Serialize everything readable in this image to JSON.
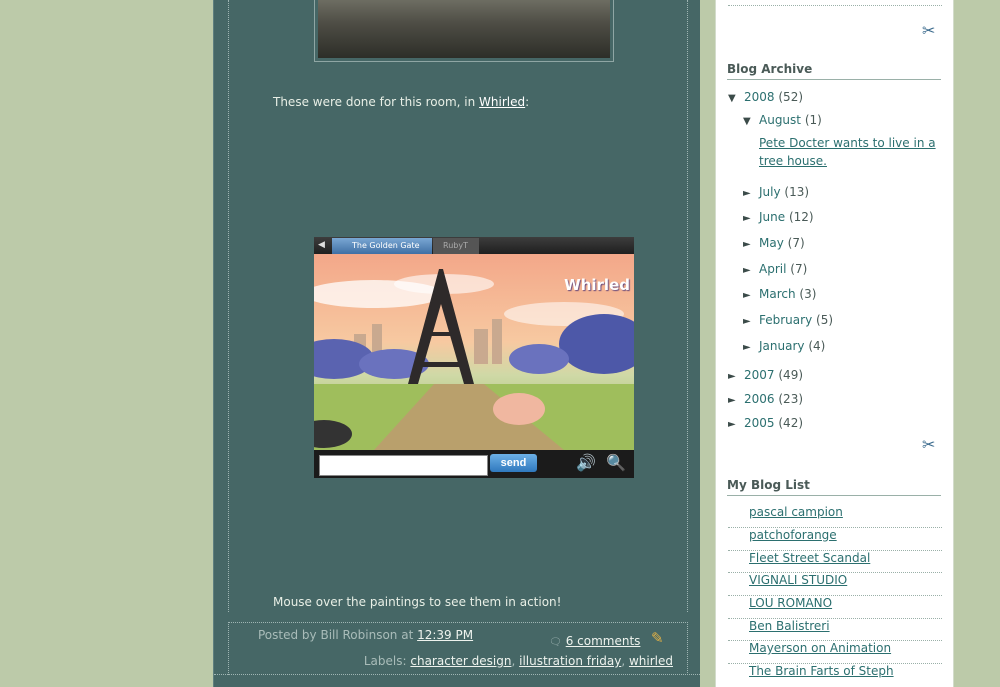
{
  "post": {
    "intro_text": "These were done for this room, in ",
    "intro_link": "Whirled",
    "intro_suffix": ":",
    "game_tab_active": "The Golden Gate",
    "game_tab_other": "RubyT",
    "game_logo": "Whirled",
    "send_label": "send",
    "mouseover_text": "Mouse over the paintings to see them in action!",
    "posted_by": "Posted by Bill Robinson at",
    "time": "12:39 PM",
    "comments": "6 comments",
    "labels_prefix": "Labels:",
    "labels": [
      "character design",
      "illustration friday",
      "whirled"
    ]
  },
  "sidebar": {
    "archive_title": "Blog Archive",
    "archive": [
      {
        "tri": "▼",
        "label": "2008",
        "count": "(52)"
      },
      {
        "tri": "▼",
        "label": "August",
        "count": "(1)"
      },
      {
        "tri": "►",
        "label": "July",
        "count": "(13)"
      },
      {
        "tri": "►",
        "label": "June",
        "count": "(12)"
      },
      {
        "tri": "►",
        "label": "May",
        "count": "(7)"
      },
      {
        "tri": "►",
        "label": "April",
        "count": "(7)"
      },
      {
        "tri": "►",
        "label": "March",
        "count": "(3)"
      },
      {
        "tri": "►",
        "label": "February",
        "count": "(5)"
      },
      {
        "tri": "►",
        "label": "January",
        "count": "(4)"
      },
      {
        "tri": "►",
        "label": "2007",
        "count": "(49)"
      },
      {
        "tri": "►",
        "label": "2006",
        "count": "(23)"
      },
      {
        "tri": "►",
        "label": "2005",
        "count": "(42)"
      }
    ],
    "archive_post": "Pete Docter wants to live in a tree house.",
    "bloglist_title": "My Blog List",
    "bloglist": [
      "pascal campion",
      "patchoforange",
      "Fleet Street Scandal",
      "VIGNALI STUDIO",
      "LOU ROMANO",
      "Ben Balistreri",
      "Mayerson on Animation",
      "The Brain Farts of Steph"
    ]
  }
}
